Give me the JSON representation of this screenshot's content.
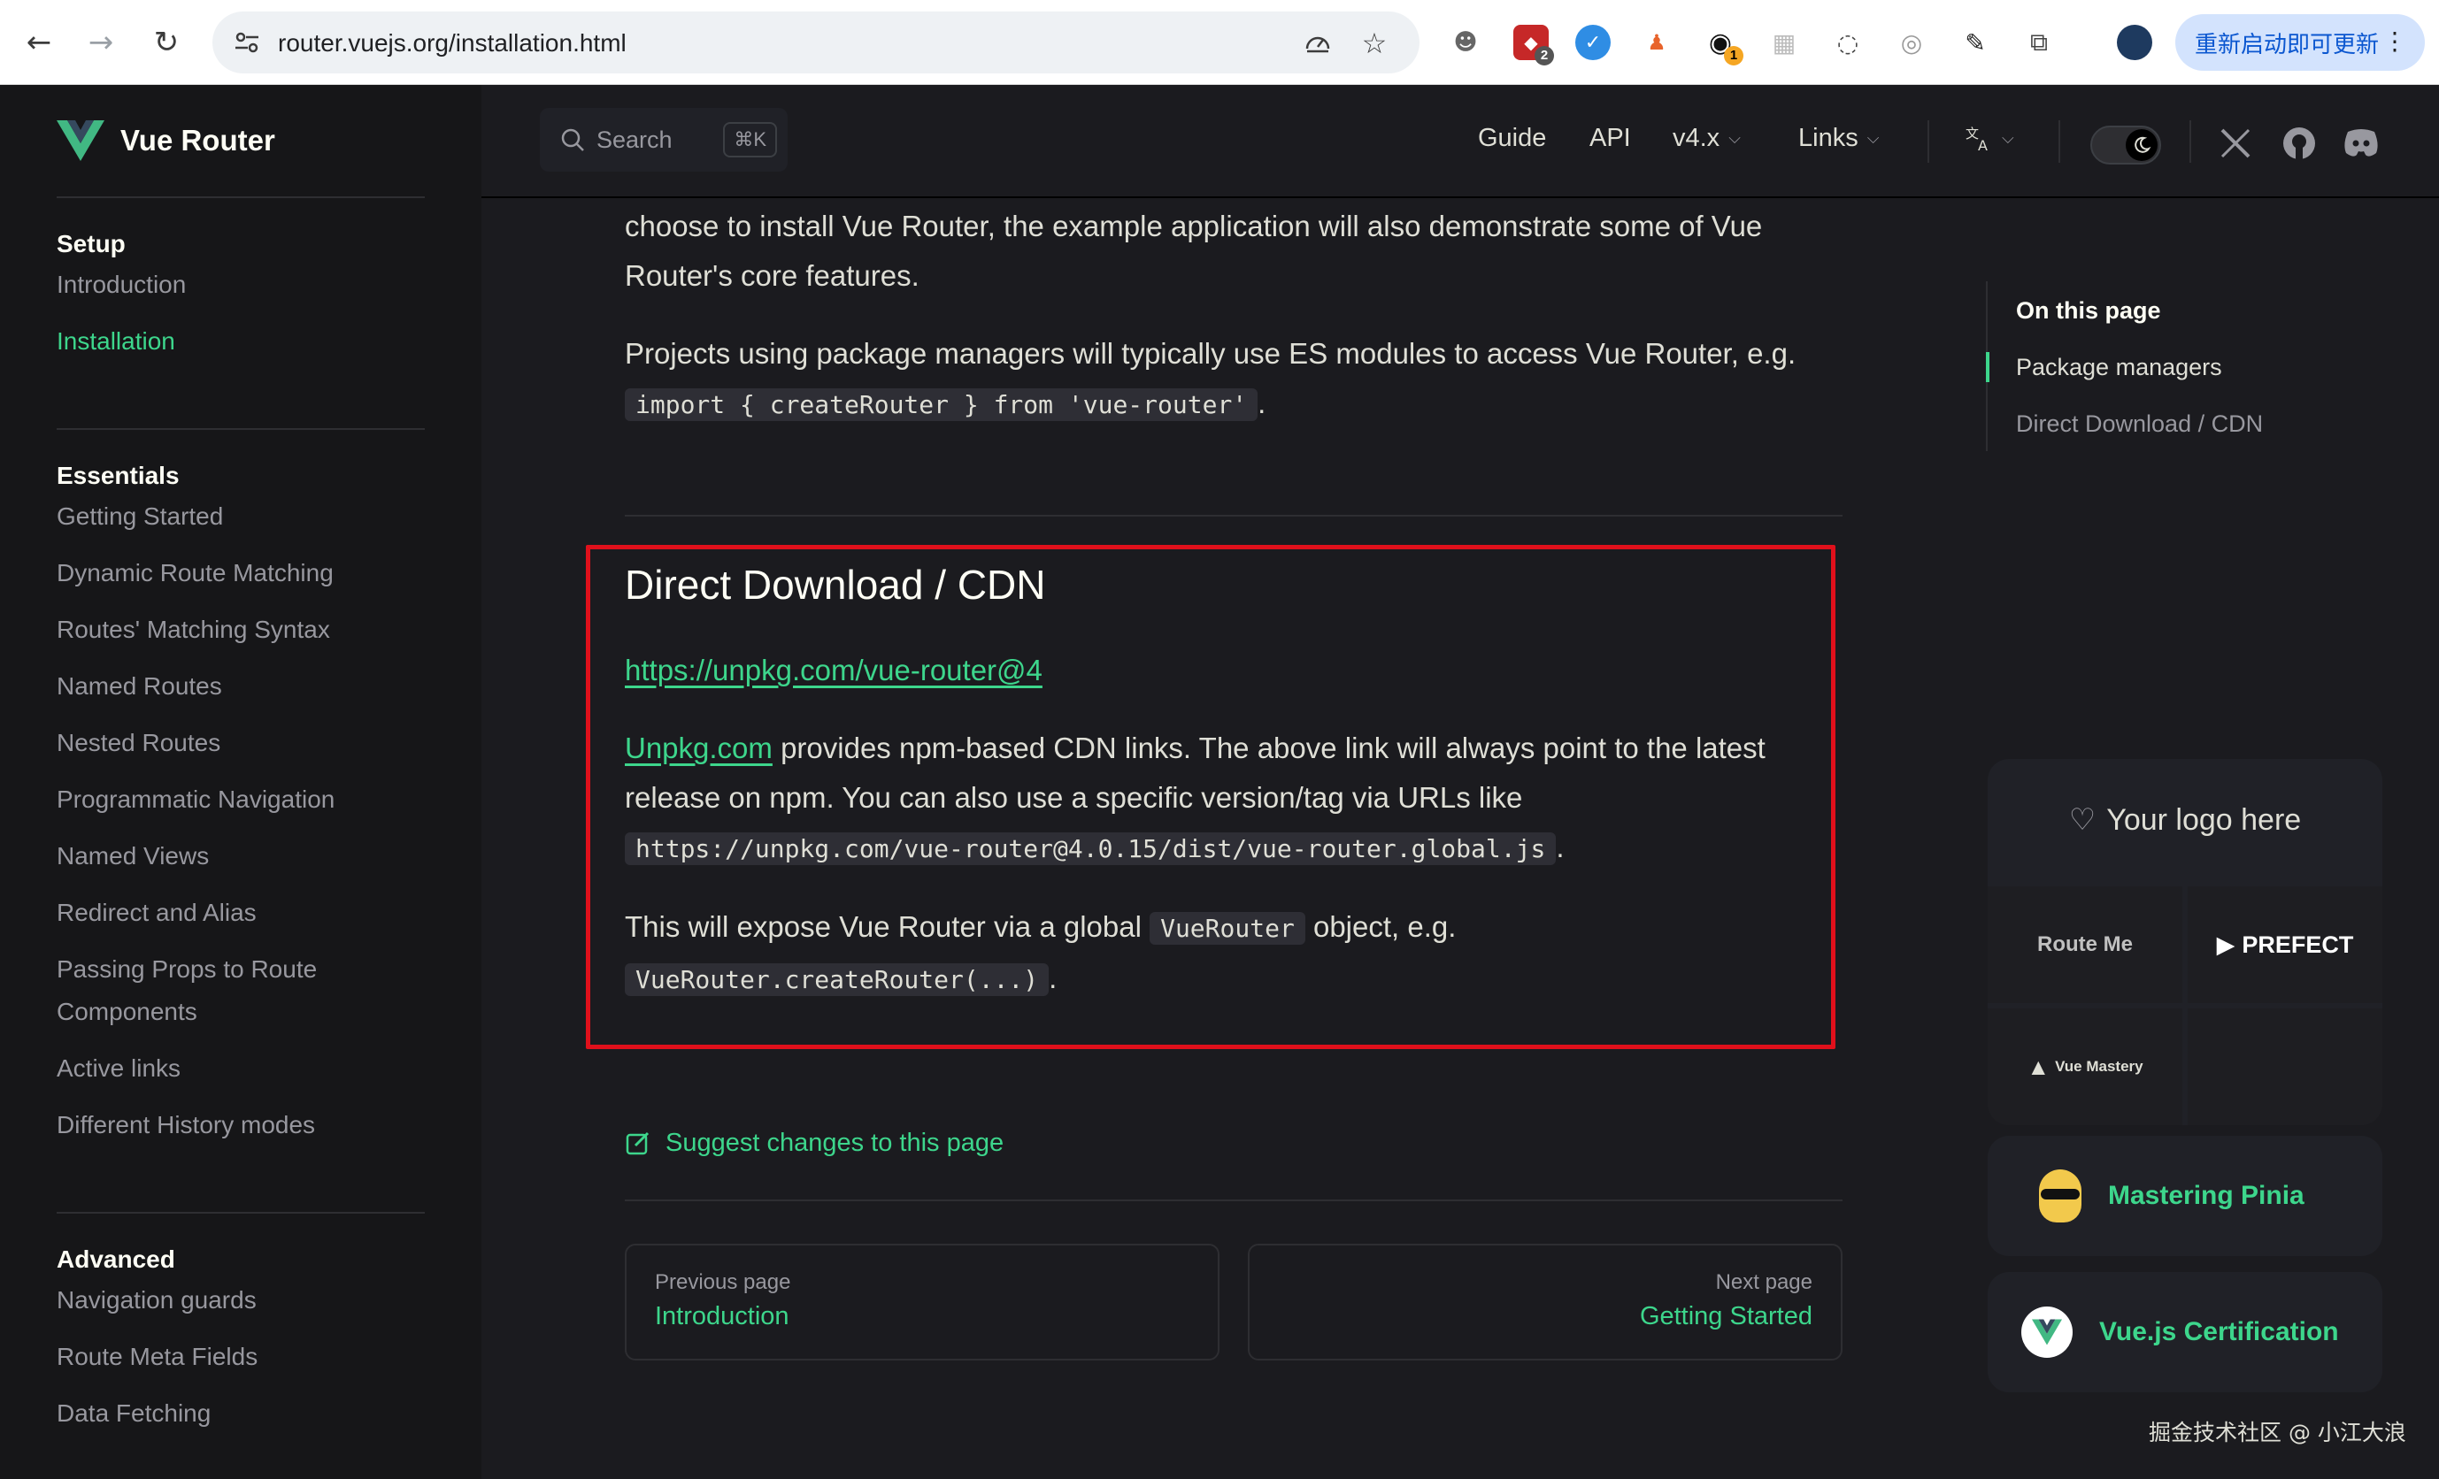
{
  "browser": {
    "url": "router.vuejs.org/installation.html",
    "update_label": "重新启动即可更新",
    "ext_badges": [
      "2",
      "1"
    ]
  },
  "sidebar": {
    "brand": "Vue Router",
    "groups": [
      {
        "title": "Setup",
        "items": [
          "Introduction",
          "Installation"
        ]
      },
      {
        "title": "Essentials",
        "items": [
          "Getting Started",
          "Dynamic Route Matching",
          "Routes' Matching Syntax",
          "Named Routes",
          "Nested Routes",
          "Programmatic Navigation",
          "Named Views",
          "Redirect and Alias",
          "Passing Props to Route Components",
          "Active links",
          "Different History modes"
        ]
      },
      {
        "title": "Advanced",
        "items": [
          "Navigation guards",
          "Route Meta Fields",
          "Data Fetching"
        ]
      }
    ],
    "active_item": "Installation"
  },
  "topbar": {
    "search_label": "Search",
    "search_shortcut": "⌘K",
    "nav": [
      "Guide",
      "API",
      "v4.x",
      "Links"
    ]
  },
  "content": {
    "p1": "choose to install Vue Router, the example application will also demonstrate some of Vue Router's core features.",
    "p2": "Projects using package managers will typically use ES modules to access Vue Router, e.g.",
    "p2_code": "import { createRouter } from 'vue-router'",
    "h2": "Direct Download / CDN",
    "cdn_link": "https://unpkg.com/vue-router@4",
    "p3_link": "Unpkg.com",
    "p3": " provides npm-based CDN links. The above link will always point to the latest release on npm. You can also use a specific version/tag via URLs like",
    "p3_code": "https://unpkg.com/vue-router@4.0.15/dist/vue-router.global.js",
    "p4_a": "This will expose Vue Router via a global ",
    "p4_code1": "VueRouter",
    "p4_b": " object, e.g.",
    "p4_code2": "VueRouter.createRouter(...)",
    "suggest": "Suggest changes to this page",
    "prev_small": "Previous page",
    "prev_big": "Introduction",
    "next_small": "Next page",
    "next_big": "Getting Started",
    "period": "."
  },
  "aside": {
    "toc_title": "On this page",
    "toc_items": [
      "Package managers",
      "Direct Download / CDN"
    ],
    "your_logo": "Your logo here",
    "sponsors": [
      "Route Me",
      "PREFECT",
      "Vue Mastery"
    ],
    "promo1": "Mastering Pinia",
    "promo2": "Vue.js Certification"
  },
  "watermark": "掘金技术社区 @ 小江大浪",
  "colors": {
    "accent": "#3dd68c",
    "highlight_box": "#e0101b",
    "background": "#1b1b1f"
  }
}
